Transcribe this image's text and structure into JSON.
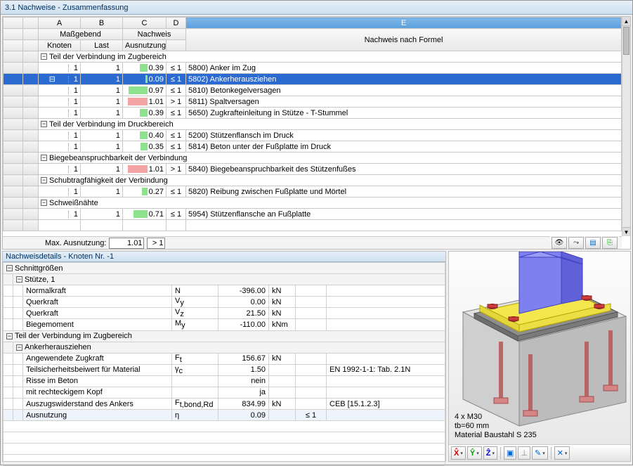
{
  "title": "3.1 Nachweise - Zusammenfassung",
  "cols": {
    "A": "A",
    "B": "B",
    "C": "C",
    "D": "D",
    "E": "E",
    "knoten": "Knoten",
    "last": "Last",
    "ausnutzung": "Ausnutzung",
    "massgebend": "Maßgebend",
    "nachweis": "Nachweis",
    "formel": "Nachweis nach Formel"
  },
  "groups": [
    {
      "title": "Teil der Verbindung im Zugbereich",
      "rows": [
        {
          "k": "1",
          "l": "1",
          "u": 0.39,
          "cmp": "≤ 1",
          "d": "5800) Anker im Zug",
          "sel": false
        },
        {
          "k": "1",
          "l": "1",
          "u": 0.09,
          "cmp": "≤ 1",
          "d": "5802) Ankerherausziehen",
          "sel": true
        },
        {
          "k": "1",
          "l": "1",
          "u": 0.97,
          "cmp": "≤ 1",
          "d": "5810) Betonkegelversagen",
          "sel": false
        },
        {
          "k": "1",
          "l": "1",
          "u": 1.01,
          "cmp": "> 1",
          "d": "5811) Spaltversagen",
          "sel": false,
          "over": true
        },
        {
          "k": "1",
          "l": "1",
          "u": 0.39,
          "cmp": "≤ 1",
          "d": "5650) Zugkrafteinleitung in Stütze - T-Stummel",
          "sel": false
        }
      ]
    },
    {
      "title": "Teil der Verbindung im Druckbereich",
      "rows": [
        {
          "k": "1",
          "l": "1",
          "u": 0.4,
          "cmp": "≤ 1",
          "d": "5200) Stützenflansch im Druck"
        },
        {
          "k": "1",
          "l": "1",
          "u": 0.35,
          "cmp": "≤ 1",
          "d": "5814) Beton unter der Fußplatte im Druck"
        }
      ]
    },
    {
      "title": "Biegebeanspruchbarkeit der Verbindung",
      "rows": [
        {
          "k": "1",
          "l": "1",
          "u": 1.01,
          "cmp": "> 1",
          "d": "5840) Biegebeanspruchbarkeit des Stützenfußes",
          "over": true
        }
      ]
    },
    {
      "title": "Schubtragfähigkeit der Verbindung",
      "rows": [
        {
          "k": "1",
          "l": "1",
          "u": 0.27,
          "cmp": "≤ 1",
          "d": "5820) Reibung zwischen Fußplatte und Mörtel"
        }
      ]
    },
    {
      "title": "Schweißnähte",
      "rows": [
        {
          "k": "1",
          "l": "1",
          "u": 0.71,
          "cmp": "≤ 1",
          "d": "5954) Stützenflansche an Fußplatte"
        }
      ]
    }
  ],
  "max": {
    "label": "Max. Ausnutzung:",
    "val": "1.01",
    "cmp": "> 1"
  },
  "details": {
    "title": "Nachweisdetails - Knoten Nr. -1",
    "schnitt": "Schnittgrößen",
    "stuetze": "Stütze, 1",
    "rows1": [
      {
        "n": "Normalkraft",
        "s": "N",
        "v": "-396.00",
        "u": "kN"
      },
      {
        "n": "Querkraft",
        "s": "V",
        "sub": "y",
        "v": "0.00",
        "u": "kN"
      },
      {
        "n": "Querkraft",
        "s": "V",
        "sub": "z",
        "v": "21.50",
        "u": "kN"
      },
      {
        "n": "Biegemoment",
        "s": "M",
        "sub": "y",
        "v": "-110.00",
        "u": "kNm"
      }
    ],
    "g2": "Teil der Verbindung im Zugbereich",
    "g3": "Ankerherausziehen",
    "rows2": [
      {
        "n": "Angewendete Zugkraft",
        "s": "F",
        "sub": "t",
        "v": "156.67",
        "u": "kN",
        "ref": ""
      },
      {
        "n": "Teilsicherheitsbeiwert für Material",
        "s": "γ",
        "sub": "c",
        "v": "1.50",
        "u": "",
        "ref": "EN 1992-1-1: Tab. 2.1N"
      },
      {
        "n": "Risse im Beton",
        "s": "",
        "v": "nein",
        "u": "",
        "ref": ""
      },
      {
        "n": "mit rechteckigem Kopf",
        "s": "",
        "v": "ja",
        "u": "",
        "ref": ""
      },
      {
        "n": "Auszugswiderstand des Ankers",
        "s": "F",
        "sub": "t,bond,Rd",
        "v": "834.99",
        "u": "kN",
        "ref": "CEB [15.1.2.3]"
      },
      {
        "n": "Ausnutzung",
        "s": "η",
        "v": "0.09",
        "u": "",
        "ref": "",
        "cmp": "≤ 1",
        "hl": true
      }
    ]
  },
  "viewer": {
    "l1": "4 x M30",
    "l2": "tb=60 mm",
    "l3": "Material Baustahl S 235"
  }
}
